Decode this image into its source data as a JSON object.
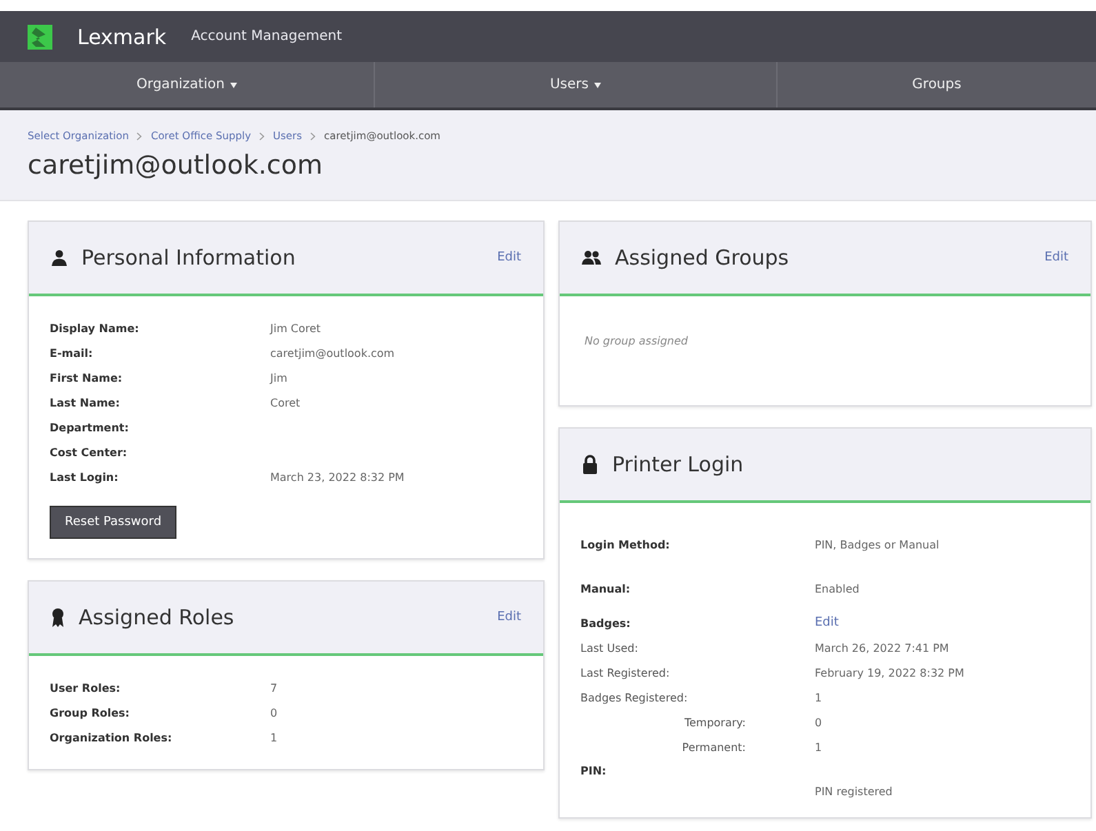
{
  "header": {
    "brand": "Lexmark",
    "app_title": "Account Management"
  },
  "nav": [
    {
      "label": "Organization",
      "dropdown": true
    },
    {
      "label": "Users",
      "dropdown": true
    },
    {
      "label": "Groups",
      "dropdown": false
    }
  ],
  "breadcrumb": [
    "Select Organization",
    "Coret Office Supply",
    "Users",
    "caretjim@outlook.com"
  ],
  "page_title": "caretjim@outlook.com",
  "personal_information": {
    "title": "Personal Information",
    "edit": "Edit",
    "rows": [
      {
        "label": "Display Name:",
        "value": "Jim Coret"
      },
      {
        "label": "E-mail:",
        "value": "caretjim@outlook.com"
      },
      {
        "label": "First Name:",
        "value": "Jim"
      },
      {
        "label": "Last Name:",
        "value": "Coret"
      },
      {
        "label": "Department:"
      },
      {
        "label": "Cost Center:"
      },
      {
        "label": "Last Login:",
        "value": "March 23, 2022 8:32 PM"
      }
    ],
    "button": "Reset Password"
  },
  "assigned_roles": {
    "title": "Assigned Roles",
    "edit": "Edit",
    "rows": [
      {
        "label": "User Roles:",
        "value": "7"
      },
      {
        "label": "Group Roles:",
        "value": "0"
      },
      {
        "label": "Organization Roles:",
        "value": "1"
      }
    ]
  },
  "assigned_groups": {
    "title": "Assigned Groups",
    "edit": "Edit",
    "empty_text": "No group assigned"
  },
  "printer_login": {
    "title": "Printer Login",
    "rows": [
      {
        "kind": "main",
        "label": "Login Method:",
        "value": "PIN, Badges or Manual"
      },
      {
        "kind": "main",
        "label": "Manual:",
        "value": "Enabled"
      },
      {
        "kind": "link",
        "label": "Badges:",
        "value": "Edit"
      },
      {
        "kind": "detail",
        "label": "Last Used:",
        "value": "March 26, 2022 7:41 PM"
      },
      {
        "kind": "detail",
        "label": "Last Registered:",
        "value": "February 19, 2022 8:32 PM"
      },
      {
        "kind": "detail",
        "label": "Badges Registered:",
        "value": "1"
      },
      {
        "kind": "sub",
        "label": "Temporary:",
        "value": "0"
      },
      {
        "kind": "sub",
        "label": "Permanent:",
        "value": "1"
      },
      {
        "kind": "stacked",
        "label": "PIN:",
        "value": "PIN registered"
      }
    ]
  }
}
